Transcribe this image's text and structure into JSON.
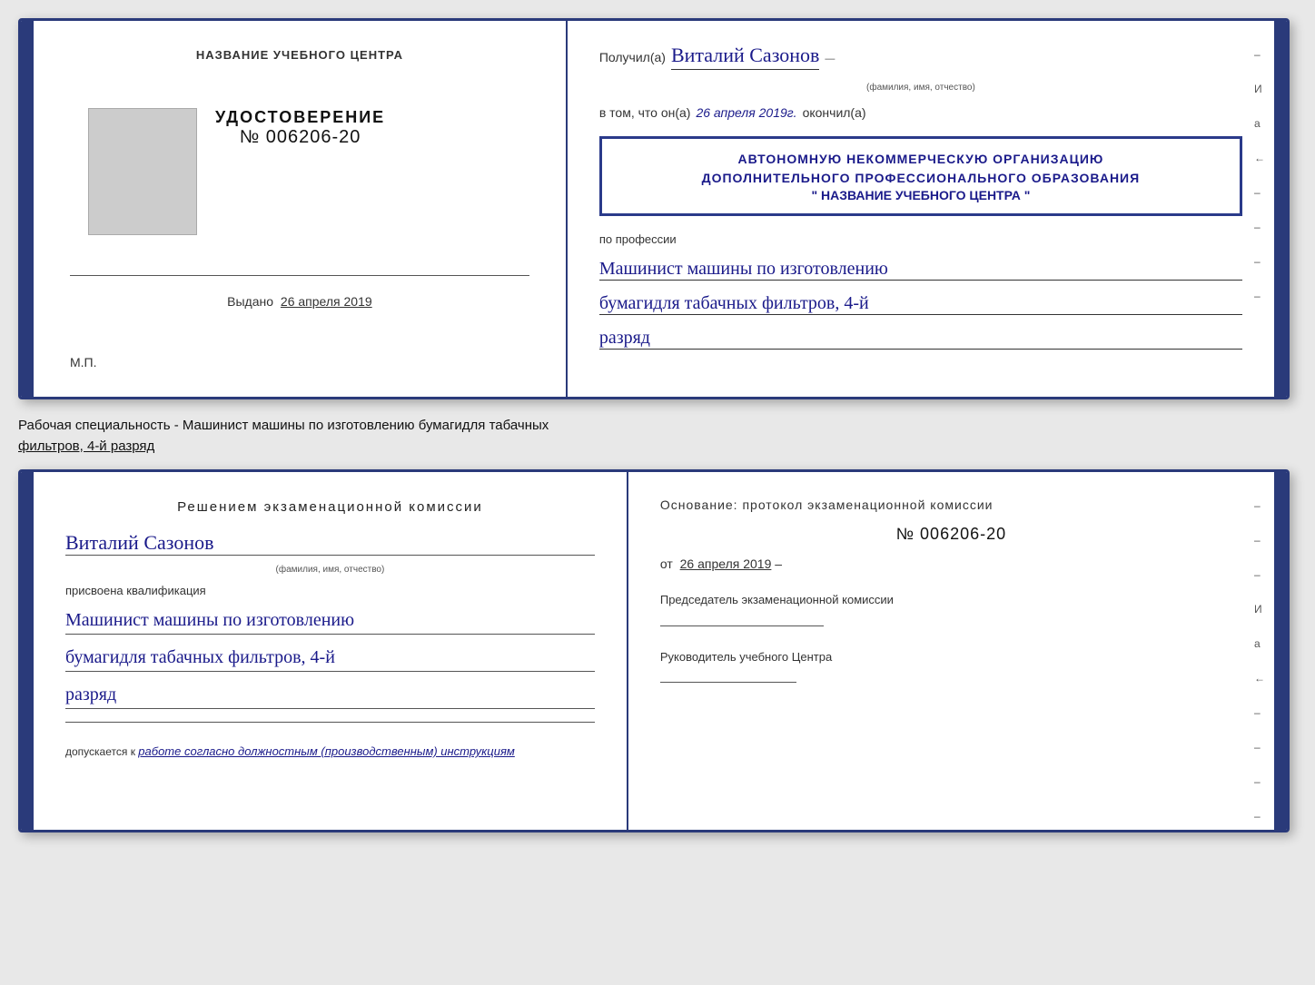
{
  "top_cert": {
    "left": {
      "header": "НАЗВАНИЕ УЧЕБНОГО ЦЕНТРА",
      "doc_type": "УДОСТОВЕРЕНИЕ",
      "doc_number": "№ 006206-20",
      "issued_label": "Выдано",
      "issued_date": "26 апреля 2019",
      "mp_label": "М.П."
    },
    "right": {
      "received_label": "Получил(а)",
      "recipient_name": "Виталий Сазонов",
      "fio_subtitle": "(фамилия, имя, отчество)",
      "in_that_label": "в том, что он(а)",
      "date_cursive": "26 апреля 2019г.",
      "finished_label": "окончил(а)",
      "stamp_line1": "АВТОНОМНУЮ НЕКОММЕРЧЕСКУЮ ОРГАНИЗАЦИЮ",
      "stamp_line2": "ДОПОЛНИТЕЛЬНОГО ПРОФЕССИОНАЛЬНОГО ОБРАЗОВАНИЯ",
      "stamp_line3": "\" НАЗВАНИЕ УЧЕБНОГО ЦЕНТРА \"",
      "profession_label": "по профессии",
      "profession_line1": "Машинист машины по изготовлению",
      "profession_line2": "бумагидля табачных фильтров, 4-й",
      "profession_line3": "разряд",
      "side_marks": [
        "-",
        "И",
        "а",
        "←",
        "-",
        "-",
        "-",
        "-"
      ]
    }
  },
  "middle_label": {
    "text": "Рабочая специальность - Машинист машины по изготовлению бумагидля табачных",
    "text2": "фильтров, 4-й разряд"
  },
  "bottom_exam": {
    "left": {
      "title": "Решением  экзаменационной  комиссии",
      "name_cursive": "Виталий Сазонов",
      "fio_subtitle": "(фамилия, имя, отчество)",
      "assigned_label": "присвоена квалификация",
      "qualification_line1": "Машинист машины по изготовлению",
      "qualification_line2": "бумагидля табачных фильтров, 4-й",
      "qualification_line3": "разряд",
      "allowed_prefix": "допускается к",
      "allowed_text": "работе согласно должностным (производственным) инструкциям"
    },
    "right": {
      "basis_label": "Основание:  протокол  экзаменационной  комиссии",
      "protocol_number": "№  006206-20",
      "date_prefix": "от",
      "date_value": "26 апреля 2019",
      "chairman_label": "Председатель экзаменационной комиссии",
      "director_label": "Руководитель учебного Центра",
      "side_marks": [
        "-",
        "-",
        "-",
        "И",
        "а",
        "←",
        "-",
        "-",
        "-",
        "-"
      ]
    }
  }
}
